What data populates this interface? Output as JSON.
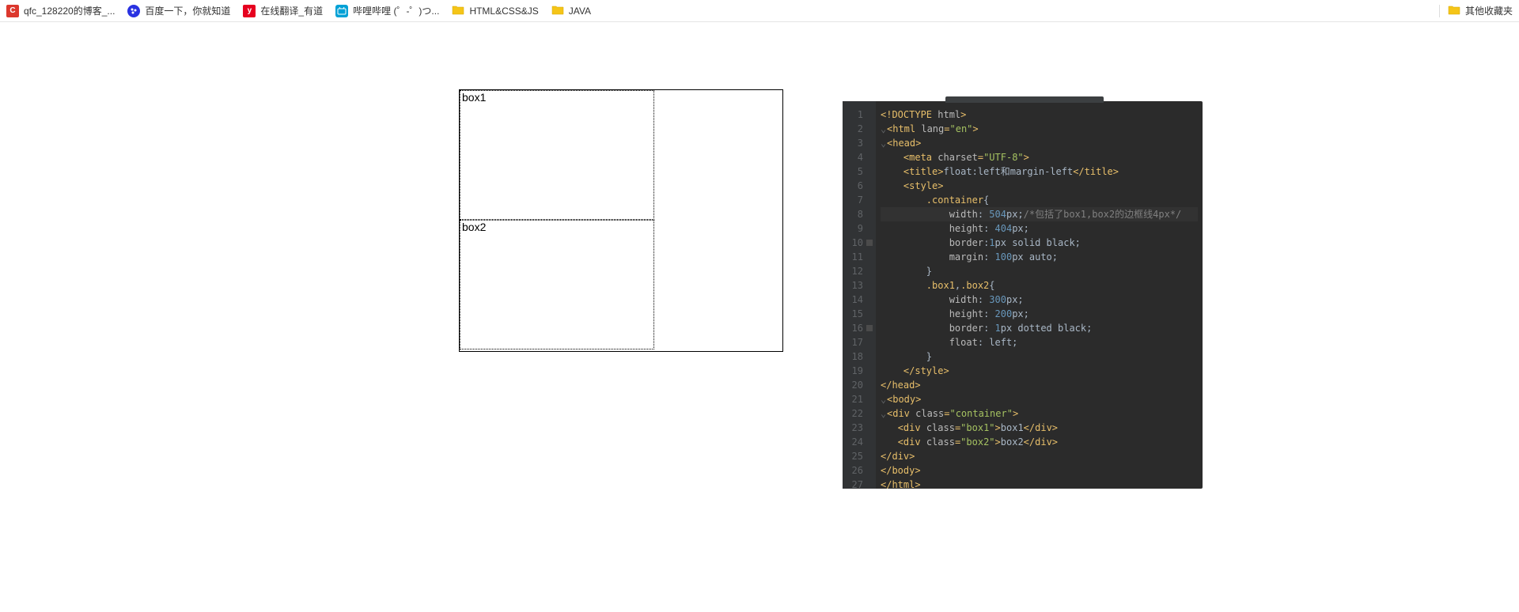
{
  "bookmarks": {
    "left": [
      {
        "label": "qfc_128220的博客_...",
        "iconClass": "ico-c",
        "iconText": "C"
      },
      {
        "label": "百度一下，你就知道",
        "iconClass": "ico-baidu",
        "iconText": ""
      },
      {
        "label": "在线翻译_有道",
        "iconClass": "ico-y",
        "iconText": "y"
      },
      {
        "label": "哔哩哔哩 (゜-゜)つ...",
        "iconClass": "ico-bili",
        "iconText": ""
      },
      {
        "label": "HTML&CSS&JS",
        "isFolder": true
      },
      {
        "label": "JAVA",
        "isFolder": true
      }
    ],
    "right": {
      "label": "其他收藏夹"
    }
  },
  "demo": {
    "box1": "box1",
    "box2": "box2"
  },
  "code": {
    "lines": [
      {
        "n": "1",
        "html": "<span class='tag'>&lt;!DOCTYPE <span class='attr'>html</span>&gt;</span>"
      },
      {
        "n": "2",
        "html": "<span class='fold'>⌄</span><span class='tag'>&lt;html <span class='attr'>lang</span>=<span class='attrval'>\"en\"</span>&gt;</span>"
      },
      {
        "n": "3",
        "html": "<span class='fold'>⌄</span><span class='tag'>&lt;head&gt;</span>"
      },
      {
        "n": "4",
        "html": "    <span class='tag'>&lt;meta <span class='attr'>charset</span>=<span class='attrval'>\"UTF-8\"</span>&gt;</span>"
      },
      {
        "n": "5",
        "html": "    <span class='tag'>&lt;title&gt;</span>float:left和margin-left<span class='tag'>&lt;/title&gt;</span>"
      },
      {
        "n": "6",
        "html": "    <span class='tag'>&lt;style&gt;</span>"
      },
      {
        "n": "7",
        "html": "        <span class='sel'>.container</span><span class='punc'>{</span>"
      },
      {
        "n": "8",
        "cursor": true,
        "html": "            <span class='prop'>width</span>: <span class='num'>504</span>px;<span class='cmt'>/*包括了box1,box2的边框线4px*/</span>"
      },
      {
        "n": "9",
        "html": "            <span class='prop'>height</span>: <span class='num'>404</span>px;"
      },
      {
        "n": "10",
        "bp": true,
        "html": "            <span class='prop'>border</span>:<span class='num'>1</span>px solid black;"
      },
      {
        "n": "11",
        "html": "            <span class='prop'>margin</span>: <span class='num'>100</span>px auto;"
      },
      {
        "n": "12",
        "html": "        <span class='punc'>}</span>"
      },
      {
        "n": "13",
        "html": "        <span class='sel'>.box1</span>,<span class='sel'>.box2</span><span class='punc'>{</span>"
      },
      {
        "n": "14",
        "html": "            <span class='prop'>width</span>: <span class='num'>300</span>px;"
      },
      {
        "n": "15",
        "html": "            <span class='prop'>height</span>: <span class='num'>200</span>px;"
      },
      {
        "n": "16",
        "bp": true,
        "html": "            <span class='prop'>border</span>: <span class='num'>1</span>px dotted black;"
      },
      {
        "n": "17",
        "html": "            <span class='prop'>float</span>: left;"
      },
      {
        "n": "18",
        "html": "        <span class='punc'>}</span>"
      },
      {
        "n": "19",
        "html": "    <span class='tag'>&lt;/style&gt;</span>"
      },
      {
        "n": "20",
        "html": "<span class='tag'>&lt;/head&gt;</span>"
      },
      {
        "n": "21",
        "html": "<span class='fold'>⌄</span><span class='tag'>&lt;body&gt;</span>"
      },
      {
        "n": "22",
        "html": "<span class='fold'>⌄</span><span class='tag'>&lt;div <span class='attr'>class</span>=<span class='attrval'>\"container\"</span>&gt;</span>"
      },
      {
        "n": "23",
        "html": "   <span class='tag'>&lt;div <span class='attr'>class</span>=<span class='attrval'>\"box1\"</span>&gt;</span>box1<span class='tag'>&lt;/div&gt;</span>"
      },
      {
        "n": "24",
        "html": "   <span class='tag'>&lt;div <span class='attr'>class</span>=<span class='attrval'>\"box2\"</span>&gt;</span>box2<span class='tag'>&lt;/div&gt;</span>"
      },
      {
        "n": "25",
        "html": "<span class='tag'>&lt;/div&gt;</span>"
      },
      {
        "n": "26",
        "html": "<span class='tag'>&lt;/body&gt;</span>"
      },
      {
        "n": "27",
        "html": "<span class='tag'>&lt;/html&gt;</span>"
      }
    ]
  }
}
